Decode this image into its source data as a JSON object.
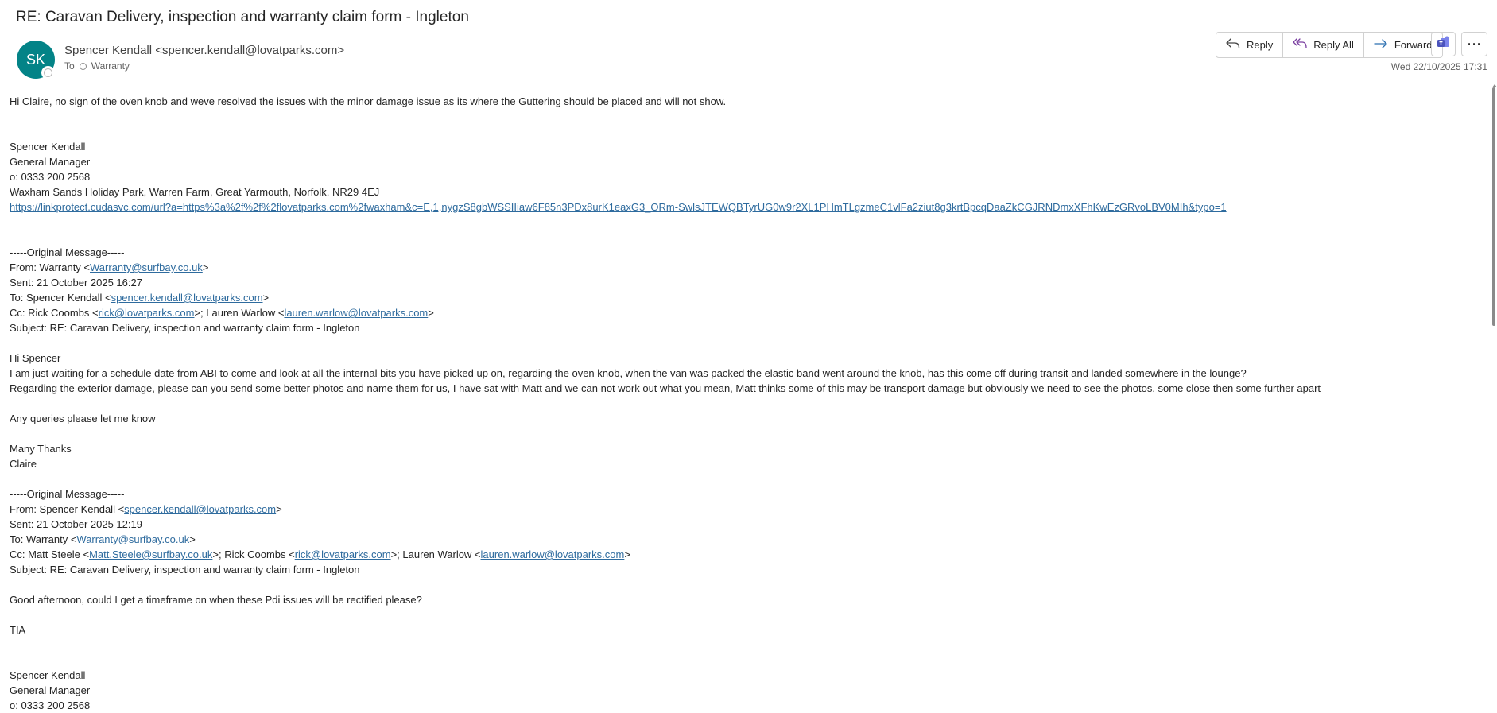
{
  "subject": "RE: Caravan Delivery, inspection and warranty claim form - Ingleton",
  "header": {
    "avatar_initials": "SK",
    "sender": "Spencer Kendall <spencer.kendall@lovatparks.com>",
    "to_label": "To",
    "to_recipient": "Warranty",
    "date": "Wed 22/10/2025 17:31"
  },
  "actions": {
    "reply": "Reply",
    "reply_all": "Reply All",
    "forward": "Forward",
    "teams_icon": "teams-icon",
    "more": "more-icon"
  },
  "colors": {
    "avatar": "#038387",
    "link": "#2e6b9e"
  },
  "body": {
    "intro": "Hi Claire, no sign of the oven knob and weve resolved the issues with the minor damage issue as its where the Guttering should be placed and will not show.",
    "sig1": {
      "name": "Spencer Kendall",
      "title": "General Manager",
      "phone": "o: 0333 200 2568",
      "address": "Waxham Sands Holiday Park, Warren Farm, Great Yarmouth, Norfolk, NR29 4EJ",
      "url": "https://linkprotect.cudasvc.com/url?a=https%3a%2f%2f%2flovatparks.com%2fwaxham&c=E,1,nygzS8gbWSSIIiaw6F85n3PDx8urK1eaxG3_ORm-SwlsJTEWQBTyrUG0w9r2XL1PHmTLgzmeC1vlFa2ziut8g3krtBpcqDaaZkCGJRNDmxXFhKwEzGRvoLBV0MIh&typo=1"
    },
    "orig1": {
      "marker": "-----Original Message-----",
      "from_prefix": "From: Warranty <",
      "from_email": "Warranty@surfbay.co.uk",
      "from_suffix": ">",
      "sent": "Sent: 21 October 2025 16:27",
      "to_prefix": "To: Spencer Kendall <",
      "to_email": "spencer.kendall@lovatparks.com",
      "to_suffix": ">",
      "cc_prefix": "Cc: Rick Coombs <",
      "cc_email1": "rick@lovatparks.com",
      "cc_mid": ">; Lauren Warlow <",
      "cc_email2": "lauren.warlow@lovatparks.com",
      "cc_suffix": ">",
      "subject": "Subject: RE: Caravan Delivery, inspection and warranty claim form - Ingleton",
      "greeting": "Hi Spencer",
      "p1": "I am just waiting for a schedule date from ABI to come and look at all the internal bits you have picked up on, regarding the oven knob, when the van was packed the elastic band went around the knob, has this come off during transit and landed somewhere in the lounge?",
      "p2": "Regarding the exterior damage, please can you send some better photos and name them for us, I have sat with Matt and we can not work out what you mean, Matt thinks some of this may be transport damage but obviously we need to see the photos, some close then some further apart",
      "queries": "Any queries please let me know",
      "thanks": "Many Thanks",
      "name": "Claire"
    },
    "orig2": {
      "marker": "-----Original Message-----",
      "from_prefix": "From: Spencer Kendall <",
      "from_email": "spencer.kendall@lovatparks.com",
      "from_suffix": ">",
      "sent": "Sent: 21 October 2025 12:19",
      "to_prefix": "To: Warranty <",
      "to_email": "Warranty@surfbay.co.uk",
      "to_suffix": ">",
      "cc_prefix": "Cc: Matt Steele <",
      "cc_email1": "Matt.Steele@surfbay.co.uk",
      "cc_mid1": ">; Rick Coombs <",
      "cc_email2": "rick@lovatparks.com",
      "cc_mid2": ">; Lauren Warlow <",
      "cc_email3": "lauren.warlow@lovatparks.com",
      "cc_suffix": ">",
      "subject": "Subject: RE: Caravan Delivery, inspection and warranty claim form - Ingleton",
      "p1": "Good afternoon, could I get a timeframe on when these Pdi issues will be rectified please?",
      "p2": "TIA"
    },
    "sig2": {
      "name": "Spencer Kendall",
      "title": "General Manager",
      "phone": "o: 0333 200 2568"
    }
  }
}
